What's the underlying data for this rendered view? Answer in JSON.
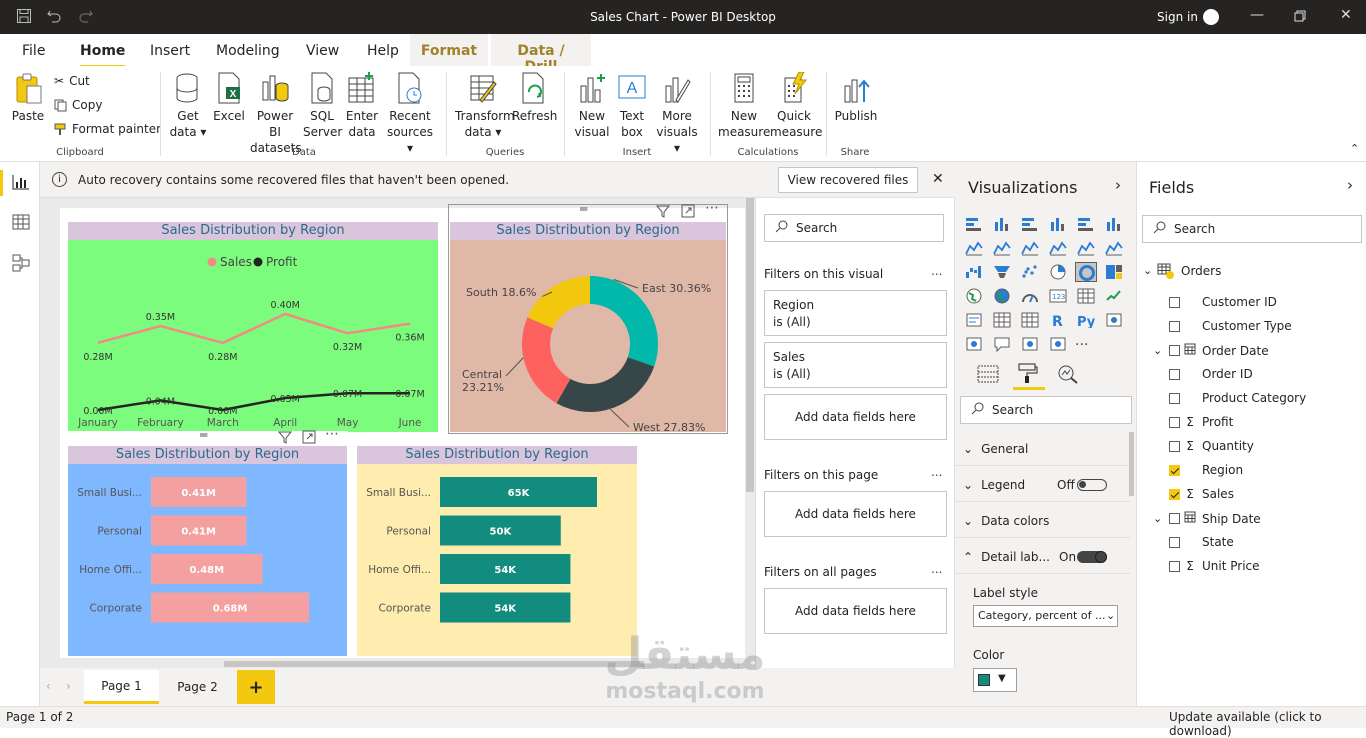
{
  "window": {
    "title": "Sales Chart - Power BI Desktop",
    "sign_in": "Sign in"
  },
  "tabs": [
    {
      "label": "File"
    },
    {
      "label": "Home"
    },
    {
      "label": "Insert"
    },
    {
      "label": "Modeling"
    },
    {
      "label": "View"
    },
    {
      "label": "Help"
    },
    {
      "label": "Format"
    },
    {
      "label": "Data / Drill"
    }
  ],
  "ribbon": {
    "clipboard": {
      "paste": "Paste",
      "cut": "Cut",
      "copy": "Copy",
      "format_painter": "Format painter",
      "group": "Clipboard"
    },
    "data": {
      "get_data_1": "Get",
      "get_data_2": "data",
      "excel": "Excel",
      "pbi_1": "Power BI",
      "pbi_2": "datasets",
      "sql_1": "SQL",
      "sql_2": "Server",
      "enter_1": "Enter",
      "enter_2": "data",
      "recent_1": "Recent",
      "recent_2": "sources",
      "group": "Data"
    },
    "queries": {
      "transform_1": "Transform",
      "transform_2": "data",
      "refresh": "Refresh",
      "group": "Queries"
    },
    "insert": {
      "new_visual_1": "New",
      "new_visual_2": "visual",
      "text_box_1": "Text",
      "text_box_2": "box",
      "more_1": "More",
      "more_2": "visuals",
      "group": "Insert"
    },
    "calculations": {
      "new_measure_1": "New",
      "new_measure_2": "measure",
      "quick_measure_1": "Quick",
      "quick_measure_2": "measure",
      "group": "Calculations"
    },
    "share": {
      "publish": "Publish",
      "group": "Share"
    }
  },
  "infobar": {
    "message": "Auto recovery contains some recovered files that haven't been opened.",
    "button": "View recovered files"
  },
  "charts": {
    "line_title": "Sales Distribution by Region",
    "donut_title": "Sales Distribution by Region",
    "bar1_title": "Sales Distribution by Region",
    "bar2_title": "Sales Distribution by Region"
  },
  "chart_data": [
    {
      "type": "line",
      "title": "Sales Distribution by Region",
      "categories": [
        "January",
        "February",
        "March",
        "April",
        "May",
        "June"
      ],
      "series": [
        {
          "name": "Sales",
          "color": "#F28B82",
          "values": [
            0.28,
            0.35,
            0.28,
            0.4,
            0.32,
            0.36
          ],
          "labels": [
            "0.28M",
            "0.35M",
            "0.28M",
            "0.40M",
            "0.32M",
            "0.36M"
          ]
        },
        {
          "name": "Profit",
          "color": "#252423",
          "values": [
            0.0,
            0.04,
            0.0,
            0.05,
            0.07,
            0.07
          ],
          "labels": [
            "0.00M",
            "0.04M",
            "0.00M",
            "0.05M",
            "0.07M",
            "0.07M"
          ]
        }
      ],
      "legend": "top-center",
      "background": "#7CFC7C"
    },
    {
      "type": "pie",
      "title": "Sales Distribution by Region",
      "slices": [
        {
          "label": "East",
          "percent": 30.36,
          "text": "East 30.36%",
          "color": "#01B8AA"
        },
        {
          "label": "West",
          "percent": 27.83,
          "text": "West 27.83%",
          "color": "#374649"
        },
        {
          "label": "Central",
          "percent": 23.21,
          "text1": "Central",
          "text2": "23.21%",
          "color": "#FD625E"
        },
        {
          "label": "South",
          "percent": 18.6,
          "text": "South 18.6%",
          "color": "#F2C80F"
        }
      ],
      "background": "#E0B8A8"
    },
    {
      "type": "bar",
      "title": "Sales Distribution by Region",
      "categories": [
        "Small Busi...",
        "Personal",
        "Home Offi...",
        "Corporate"
      ],
      "values": [
        0.41,
        0.41,
        0.48,
        0.68
      ],
      "labels": [
        "0.41M",
        "0.41M",
        "0.48M",
        "0.68M"
      ],
      "color": "#F4A0A0",
      "background": "#80B8FF"
    },
    {
      "type": "bar",
      "title": "Sales Distribution by Region",
      "categories": [
        "Small Busi...",
        "Personal",
        "Home Offi...",
        "Corporate"
      ],
      "values": [
        65,
        50,
        54,
        54
      ],
      "labels": [
        "65K",
        "50K",
        "54K",
        "54K"
      ],
      "color": "#118C7E",
      "background": "#FFEDB0"
    }
  ],
  "filters": {
    "search_placeholder": "Search",
    "on_visual": "Filters on this visual",
    "region_name": "Region",
    "region_value": "is (All)",
    "sales_name": "Sales",
    "sales_value": "is (All)",
    "add_fields": "Add data fields here",
    "on_page": "Filters on this page",
    "on_all": "Filters on all pages",
    "dots": "..."
  },
  "visualizations": {
    "title": "Visualizations",
    "search_placeholder": "Search",
    "sections": {
      "general": "General",
      "legend": "Legend",
      "legend_state": "Off",
      "data_colors": "Data colors",
      "detail": "Detail lab...",
      "detail_state": "On"
    },
    "label_style_title": "Label style",
    "label_style_value": "Category, percent of ...",
    "color_title": "Color",
    "color_value": "#118C7E",
    "more": "..."
  },
  "fields": {
    "title": "Fields",
    "search_placeholder": "Search",
    "table": "Orders",
    "items": [
      {
        "name": "Customer ID",
        "checked": false,
        "sigma": false,
        "expander": false
      },
      {
        "name": "Customer Type",
        "checked": false,
        "sigma": false,
        "expander": false
      },
      {
        "name": "Order Date",
        "checked": false,
        "sigma": false,
        "expander": true
      },
      {
        "name": "Order ID",
        "checked": false,
        "sigma": false,
        "expander": false
      },
      {
        "name": "Product Category",
        "checked": false,
        "sigma": false,
        "expander": false
      },
      {
        "name": "Profit",
        "checked": false,
        "sigma": true,
        "expander": false
      },
      {
        "name": "Quantity",
        "checked": false,
        "sigma": true,
        "expander": false
      },
      {
        "name": "Region",
        "checked": true,
        "sigma": false,
        "expander": false
      },
      {
        "name": "Sales",
        "checked": true,
        "sigma": true,
        "expander": false
      },
      {
        "name": "Ship Date",
        "checked": false,
        "sigma": false,
        "expander": true
      },
      {
        "name": "State",
        "checked": false,
        "sigma": false,
        "expander": false
      },
      {
        "name": "Unit Price",
        "checked": false,
        "sigma": true,
        "expander": false
      }
    ]
  },
  "pages": {
    "tabs": [
      "Page 1",
      "Page 2"
    ],
    "add": "+"
  },
  "status": {
    "page": "Page 1 of 2",
    "update": "Update available (click to download)"
  },
  "watermark": {
    "arabic": "مستقل",
    "latin": "mostaql.com"
  },
  "colors": {
    "accent": "#F2C811",
    "titlebar": "#252423",
    "context_tab": "#A0822B"
  }
}
